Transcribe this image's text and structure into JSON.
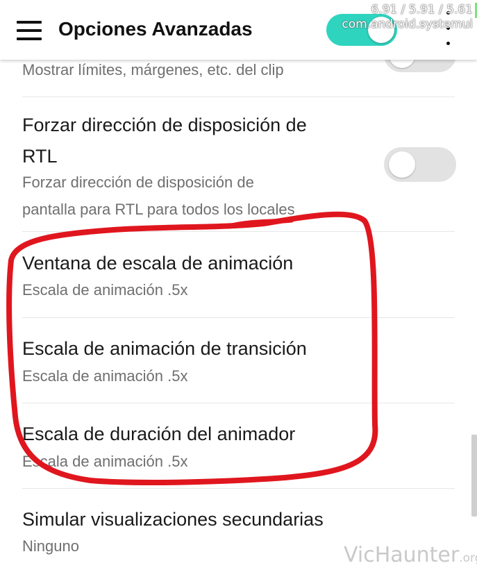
{
  "appbar": {
    "title": "Opciones Avanzadas",
    "master_toggle_on": true,
    "overlay_line1": "6.91 / 5.91 / 5.61",
    "overlay_line2": "com.android.systemui"
  },
  "settings": [
    {
      "subtitle": "Mostrar límites, márgenes, etc. del clip",
      "toggle_on": false
    },
    {
      "title_line1": "Forzar dirección de disposición de",
      "title_line2": "RTL",
      "subtitle_line1": "Forzar dirección de disposición de",
      "subtitle_line2": "pantalla para RTL para todos los locales",
      "toggle_on": false
    },
    {
      "title": "Ventana de escala de animación",
      "subtitle": "Escala de animación .5x"
    },
    {
      "title": "Escala de animación de transición",
      "subtitle": "Escala de animación .5x"
    },
    {
      "title": "Escala de duración del animador",
      "subtitle": "Escala de animación .5x"
    },
    {
      "title": "Simular visualizaciones secundarias",
      "subtitle": "Ninguno"
    }
  ],
  "annotation": {
    "color": "#e0161e",
    "shape": "hand-drawn-ellipse"
  },
  "watermark": {
    "main": "VicHaunter",
    "suffix": ".org"
  }
}
